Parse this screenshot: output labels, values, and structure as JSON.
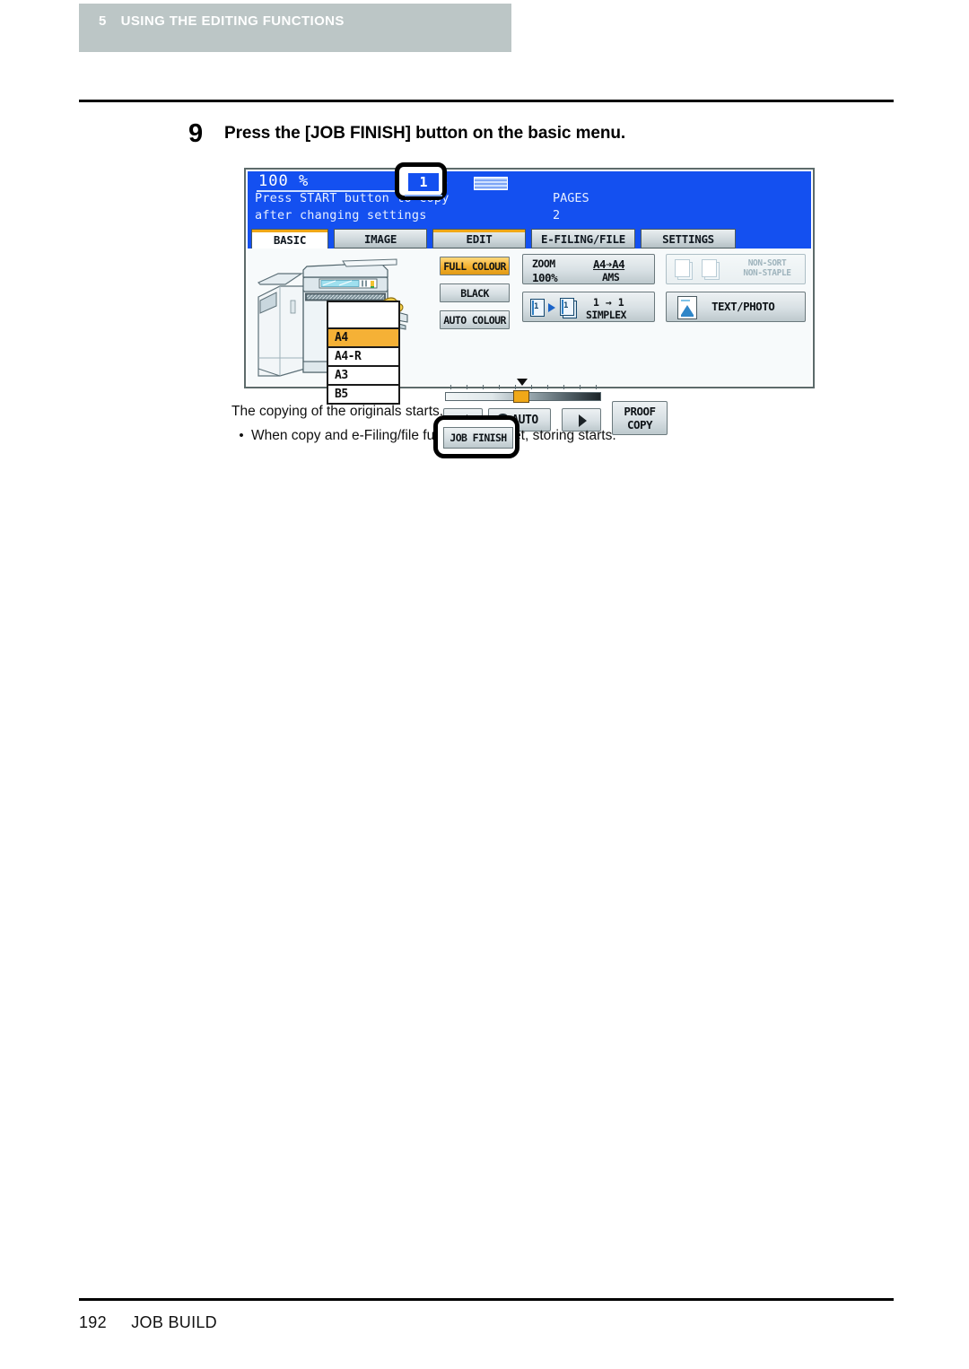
{
  "chapter": {
    "number": "5",
    "title": "USING THE EDITING FUNCTIONS"
  },
  "step": {
    "number": "9",
    "text": "Press the [JOB FINISH] button on the basic menu."
  },
  "lcd": {
    "header": {
      "zoom_ratio": "100 %",
      "copies": "1",
      "paper_size": "A4",
      "message_line1": "Press START button to copy",
      "message_line2": "after changing settings",
      "pages_label": "PAGES",
      "pages_value": "2"
    },
    "tabs": [
      {
        "label": "BASIC",
        "active": true
      },
      {
        "label": "IMAGE",
        "active": false
      },
      {
        "label": "EDIT",
        "active": false
      },
      {
        "label": "E-FILING/FILE",
        "active": false
      },
      {
        "label": "SETTINGS",
        "active": false
      }
    ],
    "drawers": [
      {
        "label": "A4",
        "selected": true
      },
      {
        "label": "A4-R",
        "selected": false
      },
      {
        "label": "A3",
        "selected": false
      },
      {
        "label": "B5",
        "selected": false
      }
    ],
    "colour_buttons": [
      {
        "label": "FULL COLOUR",
        "selected": true
      },
      {
        "label": "BLACK",
        "selected": false
      },
      {
        "label": "AUTO COLOUR",
        "selected": false
      }
    ],
    "job_finish_label": "JOB FINISH",
    "zoom_button": {
      "label": "ZOOM",
      "value": "100%",
      "sizes": "A4➔A4",
      "mode": "AMS"
    },
    "simplex_button": {
      "left_page_num": "1",
      "right_page_num": "1",
      "ratio": "1 → 1",
      "label": "SIMPLEX"
    },
    "finishing_button": {
      "line1": "NON-SORT",
      "line2": "NON-STAPLE",
      "disabled": true
    },
    "original_mode_button": {
      "label": "TEXT/PHOTO"
    },
    "density": {
      "left_arrow": "◀",
      "auto_label": "AUTO",
      "right_arrow": "▶"
    },
    "proof_copy": {
      "line1": "PROOF",
      "line2": "COPY"
    }
  },
  "caption": {
    "line1": "The copying of the originals starts.",
    "bullet_dot": "•",
    "bullet1": "When copy and e-Filing/file functions are set, storing starts."
  },
  "footer": {
    "page_number": "192",
    "section": "JOB BUILD"
  },
  "colors": {
    "lcd_blue": "#1450f0",
    "accent_amber": "#f0a818",
    "band_gray": "#bcc6c6"
  }
}
